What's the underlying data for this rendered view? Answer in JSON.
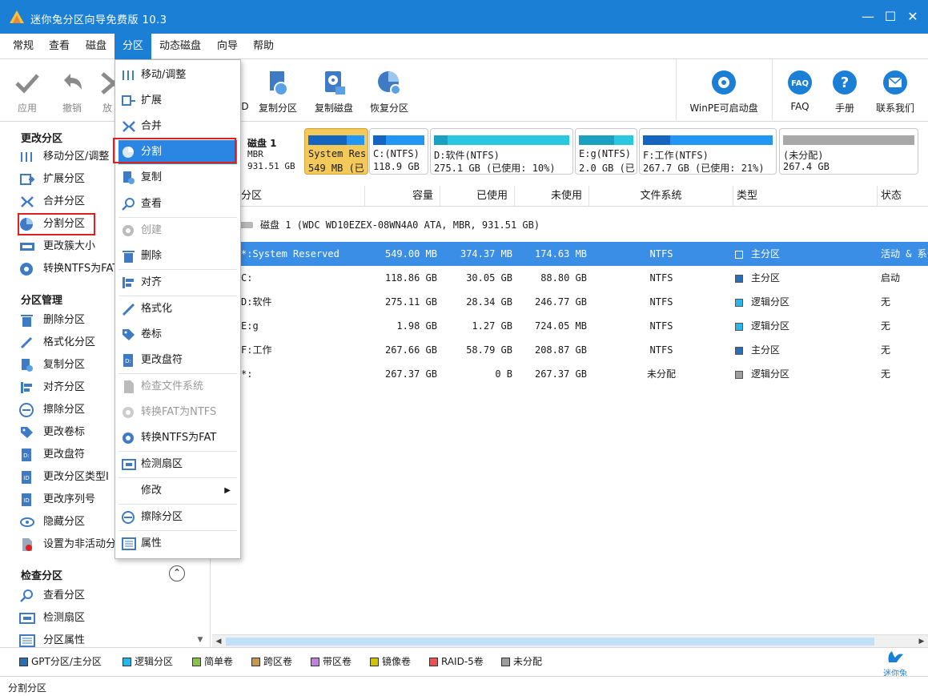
{
  "window": {
    "title": "迷你兔分区向导免费版 10.3",
    "minimize": "—",
    "maximize": "☐",
    "close": "✕"
  },
  "menubar": [
    "常规",
    "查看",
    "磁盘",
    "分区",
    "动态磁盘",
    "向导",
    "帮助"
  ],
  "toolbar": {
    "apply": "应用",
    "undo": "撤销",
    "discard": "放",
    "hidden": "D",
    "copy_partition": "复制分区",
    "copy_disk": "复制磁盘",
    "recover_partition": "恢复分区",
    "winpe": "WinPE可启动盘",
    "faq": "FAQ",
    "manual": "手册",
    "contact": "联系我们"
  },
  "leftpanel": {
    "section1": "更改分区",
    "items1": [
      "移动分区/调整",
      "扩展分区",
      "合并分区",
      "分割分区",
      "更改簇大小",
      "转换NTFS为FAT"
    ],
    "section2": "分区管理",
    "items2": [
      "删除分区",
      "格式化分区",
      "复制分区",
      "对齐分区",
      "擦除分区",
      "更改卷标",
      "更改盘符",
      "更改分区类型I",
      "更改序列号",
      "隐藏分区",
      "设置为非活动分"
    ],
    "section3": "检查分区",
    "items3": [
      "查看分区",
      "检测扇区",
      "分区属性"
    ]
  },
  "disk": {
    "name": "磁盘 1",
    "type": "MBR",
    "size": "931.51 GB",
    "header": "磁盘 1 (WDC WD10EZEX-08WN4A0 ATA, MBR, 931.51 GB)",
    "maps": [
      {
        "t1": "System Res",
        "t2": "549 MB (已",
        "used": 0.68
      },
      {
        "t1": "C:(NTFS)",
        "t2": "118.9 GB",
        "used": 0.25
      },
      {
        "t1": "D:软件(NTFS)",
        "t2": "275.1 GB (已使用: 10%)",
        "used": 0.1
      },
      {
        "t1": "E:g(NTFS)",
        "t2": "2.0 GB (已",
        "used": 0.64
      },
      {
        "t1": "F:工作(NTFS)",
        "t2": "267.7 GB (已使用: 21%)",
        "used": 0.21
      },
      {
        "t1": "(未分配)",
        "t2": "267.4 GB",
        "used": 0
      }
    ]
  },
  "table": {
    "headers": [
      "分区",
      "容量",
      "已使用",
      "未使用",
      "文件系统",
      "类型",
      "状态"
    ],
    "rows": [
      {
        "name": "*:System Reserved",
        "cap": "549.00 MB",
        "used": "374.37 MB",
        "free": "174.63 MB",
        "fs": "NTFS",
        "type": "主分区",
        "status": "活动 & 系"
      },
      {
        "name": "C:",
        "cap": "118.86 GB",
        "used": "30.05 GB",
        "free": "88.80 GB",
        "fs": "NTFS",
        "type": "主分区",
        "status": "启动"
      },
      {
        "name": "D:软件",
        "cap": "275.11 GB",
        "used": "28.34 GB",
        "free": "246.77 GB",
        "fs": "NTFS",
        "type": "逻辑分区",
        "status": "无"
      },
      {
        "name": "E:g",
        "cap": "1.98 GB",
        "used": "1.27 GB",
        "free": "724.05 MB",
        "fs": "NTFS",
        "type": "逻辑分区",
        "status": "无"
      },
      {
        "name": "F:工作",
        "cap": "267.66 GB",
        "used": "58.79 GB",
        "free": "208.87 GB",
        "fs": "NTFS",
        "type": "主分区",
        "status": "无"
      },
      {
        "name": "*:",
        "cap": "267.37 GB",
        "used": "0 B",
        "free": "267.37 GB",
        "fs": "未分配",
        "type": "逻辑分区",
        "status": "无"
      }
    ]
  },
  "legend": [
    {
      "label": "GPT分区/主分区",
      "color": "#2a6fb5"
    },
    {
      "label": "逻辑分区",
      "color": "#29b6e8"
    },
    {
      "label": "简单卷",
      "color": "#8bc34a"
    },
    {
      "label": "跨区卷",
      "color": "#c8964c"
    },
    {
      "label": "带区卷",
      "color": "#c080e0"
    },
    {
      "label": "镜像卷",
      "color": "#d4c200"
    },
    {
      "label": "RAID-5卷",
      "color": "#f05050"
    },
    {
      "label": "未分配",
      "color": "#9e9e9e"
    }
  ],
  "brand": "迷你兔",
  "status": "分割分区",
  "dropdown": [
    {
      "label": "移动/调整",
      "disabled": false
    },
    {
      "label": "扩展",
      "disabled": false
    },
    {
      "label": "合并",
      "disabled": false
    },
    {
      "label": "分割",
      "disabled": false
    },
    {
      "label": "复制",
      "disabled": false
    },
    {
      "label": "查看",
      "disabled": false
    },
    {
      "label": "创建",
      "disabled": true
    },
    {
      "label": "删除",
      "disabled": false
    },
    {
      "label": "对齐",
      "disabled": false
    },
    {
      "label": "格式化",
      "disabled": false
    },
    {
      "label": "卷标",
      "disabled": false
    },
    {
      "label": "更改盘符",
      "disabled": false
    },
    {
      "label": "检查文件系统",
      "disabled": true
    },
    {
      "label": "转换FAT为NTFS",
      "disabled": true
    },
    {
      "label": "转换NTFS为FAT",
      "disabled": false
    },
    {
      "label": "检测扇区",
      "disabled": false
    },
    {
      "label": "修改",
      "disabled": false
    },
    {
      "label": "擦除分区",
      "disabled": false
    },
    {
      "label": "属性",
      "disabled": false
    }
  ],
  "colors": {
    "accent": "#1b7fd6",
    "selected_row": "#3a8ee6",
    "highlight_box": "#e02020"
  }
}
